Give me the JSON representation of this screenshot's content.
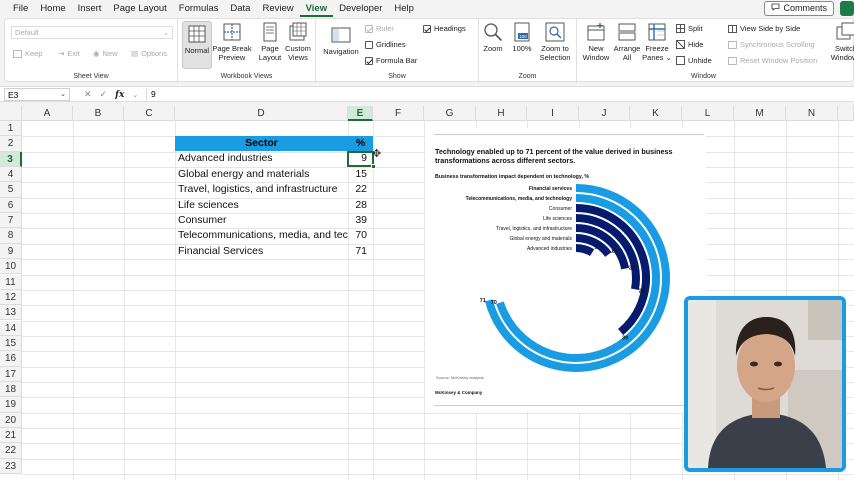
{
  "menu": {
    "tabs": [
      "File",
      "Home",
      "Insert",
      "Page Layout",
      "Formulas",
      "Data",
      "Review",
      "View",
      "Developer",
      "Help"
    ],
    "active_tab": "View",
    "comments_label": "Comments"
  },
  "ribbon": {
    "sheet_view": {
      "dropdown_value": "Default",
      "keep": "Keep",
      "exit": "Exit",
      "new": "New",
      "options": "Options",
      "label": "Sheet View"
    },
    "workbook_views": {
      "normal": "Normal",
      "page_break_1": "Page Break",
      "page_break_2": "Preview",
      "page_layout_1": "Page",
      "page_layout_2": "Layout",
      "custom_1": "Custom",
      "custom_2": "Views",
      "label": "Workbook Views"
    },
    "show": {
      "navigation": "Navigation",
      "ruler": "Ruler",
      "gridlines": "Gridlines",
      "formula_bar": "Formula Bar",
      "headings": "Headings",
      "label": "Show"
    },
    "zoom": {
      "zoom": "Zoom",
      "hundred": "100%",
      "hundred_icon": "100",
      "zoom_sel_1": "Zoom to",
      "zoom_sel_2": "Selection",
      "label": "Zoom"
    },
    "window": {
      "new_window_1": "New",
      "new_window_2": "Window",
      "arrange_1": "Arrange",
      "arrange_2": "All",
      "freeze_1": "Freeze",
      "freeze_2": "Panes",
      "split": "Split",
      "hide": "Hide",
      "unhide": "Unhide",
      "side_by_side": "View Side by Side",
      "sync_scroll": "Synchronous Scrolling",
      "reset_pos": "Reset Window Position",
      "switch_1": "Switch",
      "switch_2": "Windows",
      "label": "Window"
    }
  },
  "formula_bar": {
    "name_box": "E3",
    "value": "9"
  },
  "grid": {
    "columns": [
      "A",
      "B",
      "C",
      "D",
      "E",
      "F",
      "G",
      "H",
      "I",
      "J",
      "K",
      "L",
      "M",
      "N"
    ],
    "rows": [
      "1",
      "2",
      "3",
      "4",
      "5",
      "6",
      "7",
      "8",
      "9",
      "10",
      "11",
      "12",
      "13",
      "14",
      "15",
      "16",
      "17",
      "18",
      "19",
      "20",
      "21",
      "22",
      "23"
    ],
    "selected_col": "E",
    "selected_row": "3"
  },
  "table": {
    "header_sector": "Sector",
    "header_pct": "%",
    "rows": [
      {
        "sector": "Advanced industries",
        "pct": "9"
      },
      {
        "sector": "Global energy and materials",
        "pct": "15"
      },
      {
        "sector": "Travel, logistics, and infrastructure",
        "pct": "22"
      },
      {
        "sector": "Life sciences",
        "pct": "28"
      },
      {
        "sector": "Consumer",
        "pct": "39"
      },
      {
        "sector": "Telecommunications, media, and technology",
        "pct": "70"
      },
      {
        "sector": "Financial Services",
        "pct": "71"
      }
    ]
  },
  "chart_image": {
    "title": "Technology enabled up to 71 percent of the value derived in business transformations across different sectors.",
    "subtitle": "Business transformation impact dependent on technology, %",
    "source": "Source: McKinsey analysis",
    "brand": "McKinsey & Company"
  },
  "chart_data": {
    "type": "radial-bar",
    "title": "Technology enabled up to 71 percent of the value derived in business transformations across different sectors.",
    "subtitle": "Business transformation impact dependent on technology, %",
    "categories": [
      "Financial services",
      "Telecommunications, media, and technology",
      "Consumer",
      "Life sciences",
      "Travel, logistics, and infrastructure",
      "Global energy and materials",
      "Advanced industries"
    ],
    "values": [
      71,
      70,
      39,
      28,
      22,
      15,
      9
    ],
    "highlighted": [
      "Financial services",
      "Telecommunications, media, and technology"
    ],
    "max": 100,
    "colors": {
      "highlight": "#1a9ce3",
      "normal": "#061a6e"
    }
  },
  "colors": {
    "accent": "#1e6b35",
    "header_fill": "#1a9ce3",
    "webcam_border": "#1a9ce3"
  }
}
